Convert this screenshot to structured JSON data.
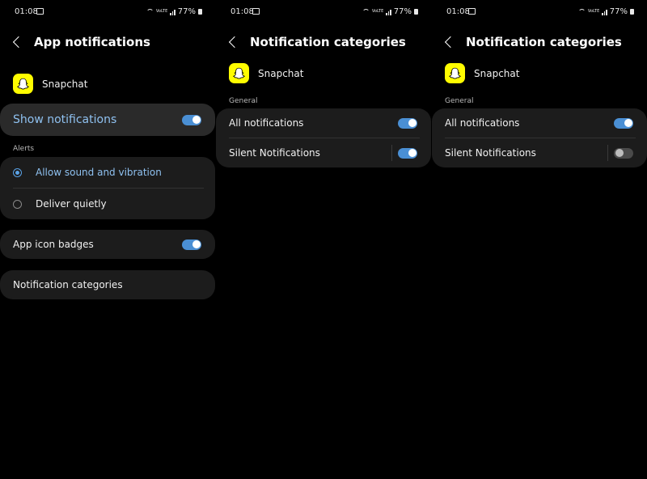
{
  "status_bar": {
    "time": "01:08",
    "battery": "77%",
    "network_tiny": "VoLTE"
  },
  "screen1": {
    "title": "App notifications",
    "app_name": "Snapchat",
    "show_notifications": {
      "label": "Show notifications",
      "enabled": true
    },
    "alerts_header": "Alerts",
    "alert_options": [
      {
        "label": "Allow sound and vibration",
        "selected": true
      },
      {
        "label": "Deliver quietly",
        "selected": false
      }
    ],
    "app_icon_badges": {
      "label": "App icon badges",
      "enabled": true
    },
    "notification_categories": "Notification categories"
  },
  "screen2": {
    "title": "Notification categories",
    "app_name": "Snapchat",
    "section": "General",
    "items": [
      {
        "label": "All notifications",
        "enabled": true
      },
      {
        "label": "Silent Notifications",
        "enabled": true
      }
    ]
  },
  "screen3": {
    "title": "Notification categories",
    "app_name": "Snapchat",
    "section": "General",
    "items": [
      {
        "label": "All notifications",
        "enabled": true
      },
      {
        "label": "Silent Notifications",
        "enabled": false
      }
    ]
  },
  "colors": {
    "accent": "#4a8fd4",
    "card": "#1c1c1c",
    "snapchat_yellow": "#FFFC00"
  }
}
